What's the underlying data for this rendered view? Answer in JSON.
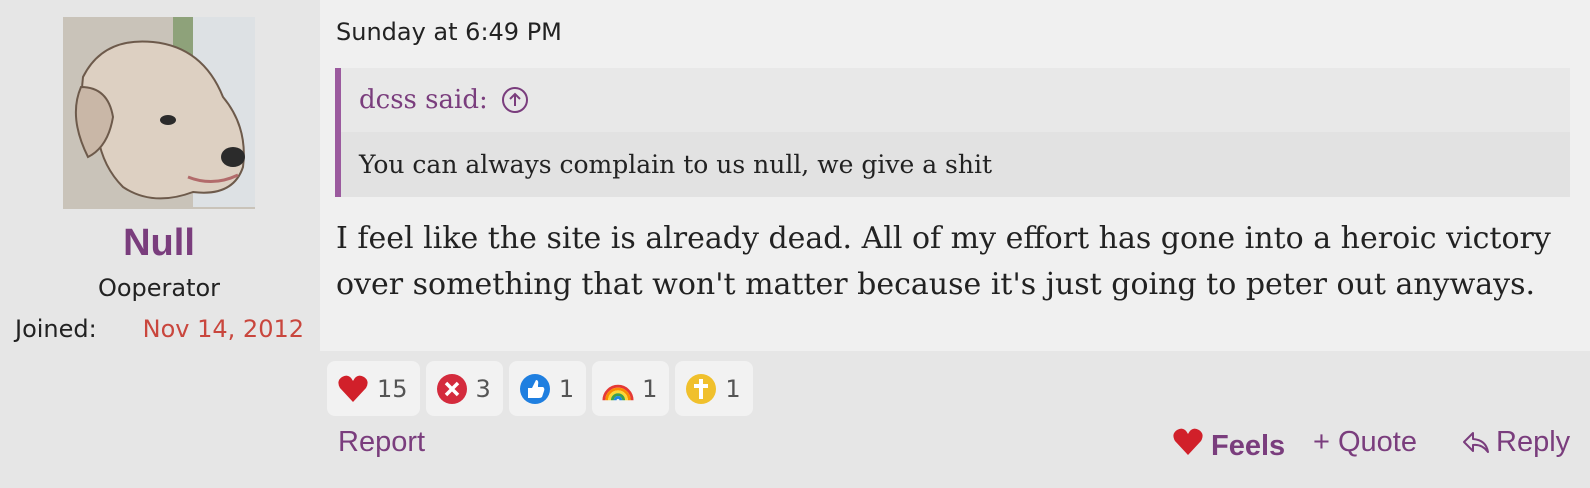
{
  "user": {
    "name": "Null",
    "title": "Ooperator",
    "joined_label": "Joined:",
    "joined_value": "Nov 14, 2012"
  },
  "post": {
    "timestamp": "Sunday at 6:49 PM",
    "quote": {
      "author_line": "dcss said:",
      "text": "You can always complain to us null, we give a shit"
    },
    "message": "I feel like the site is already dead. All of my effort has gone into a heroic victory over something that won't matter because it's just going to peter out anyways."
  },
  "reactions": [
    {
      "icon": "heart-icon",
      "count": "15"
    },
    {
      "icon": "x-icon",
      "count": "3"
    },
    {
      "icon": "thumbs-up-icon",
      "count": "1"
    },
    {
      "icon": "rainbow-icon",
      "count": "1"
    },
    {
      "icon": "cross-icon",
      "count": "1"
    }
  ],
  "actions": {
    "report": "Report",
    "feels": "Feels",
    "quote": "+ Quote",
    "reply": "Reply"
  },
  "colors": {
    "accent": "#7a3d7d",
    "joined_date": "#c9463d",
    "heart": "#d1202a"
  }
}
